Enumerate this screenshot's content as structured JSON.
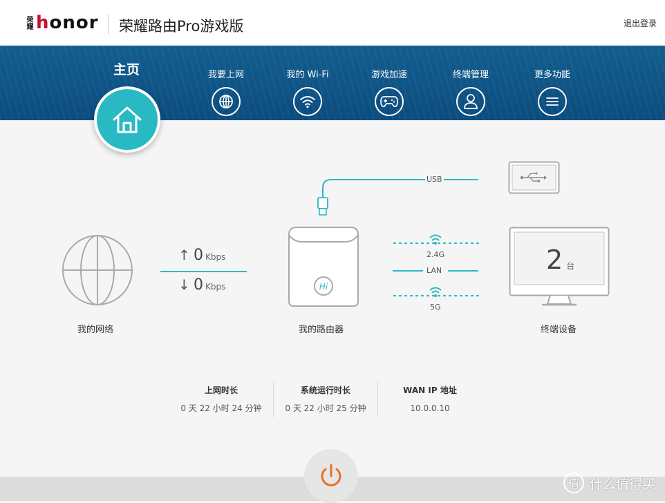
{
  "header": {
    "brand_seal": "荣耀",
    "brand_wordmark": "honor",
    "product_title": "荣耀路由Pro游戏版",
    "logout_label": "退出登录"
  },
  "nav": {
    "home_label": "主页",
    "items": [
      {
        "label": "我要上网",
        "icon": "globe-icon"
      },
      {
        "label": "我的 Wi-Fi",
        "icon": "wifi-icon"
      },
      {
        "label": "游戏加速",
        "icon": "gamepad-icon"
      },
      {
        "label": "终端管理",
        "icon": "user-icon"
      },
      {
        "label": "更多功能",
        "icon": "menu-icon"
      }
    ]
  },
  "network": {
    "label": "我的网络",
    "upload_value": "0",
    "upload_unit": "Kbps",
    "download_value": "0",
    "download_unit": "Kbps"
  },
  "router": {
    "label": "我的路由器",
    "badge": "Hi"
  },
  "links": {
    "usb": "USB",
    "wifi_24": "2.4G",
    "lan": "LAN",
    "wifi_5": "5G"
  },
  "devices": {
    "count": "2",
    "unit": "台",
    "label": "终端设备"
  },
  "stats": [
    {
      "title": "上网时长",
      "value": "0 天 22 小时 24 分钟"
    },
    {
      "title": "系统运行时长",
      "value": "0 天 22 小时 25 分钟"
    },
    {
      "title": "WAN IP 地址",
      "value": "10.0.0.10"
    }
  ],
  "watermark": {
    "badge": "值",
    "text": "什么值得买"
  },
  "colors": {
    "nav_blue": "#0f5486",
    "accent_teal": "#29b9c3",
    "power_orange": "#e8702a",
    "brand_red": "#c8102e"
  }
}
